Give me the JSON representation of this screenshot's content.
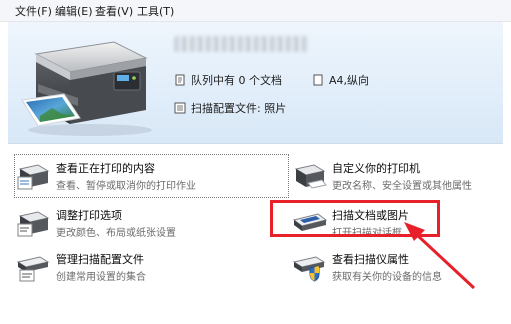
{
  "menu": {
    "items": [
      "文件(F)",
      "编辑(E)",
      "查看(V)",
      "工具(T)"
    ]
  },
  "header": {
    "queue_text": "队列中有 0 个文档",
    "paper_text": "A4,纵向",
    "scan_profile_text": "扫描配置文件: 照片"
  },
  "tasks": {
    "view_printing": {
      "title": "查看正在打印的内容",
      "desc": "查看、暂停或取消你的打印作业"
    },
    "customize_printer": {
      "title": "自定义你的打印机",
      "desc": "更改名称、安全设置或其他属性"
    },
    "print_options": {
      "title": "调整打印选项",
      "desc": "更改颜色、布局或纸张设置"
    },
    "scan_document": {
      "title": "扫描文档或图片",
      "desc": "打开扫描对话框"
    },
    "manage_profiles": {
      "title": "管理扫描配置文件",
      "desc": "创建常用设置的集合"
    },
    "scanner_properties": {
      "title": "查看扫描仪属性",
      "desc": "获取有关你的设备的信息"
    }
  },
  "colors": {
    "highlight": "#e8202a",
    "header_bg": "#e2eefa"
  }
}
